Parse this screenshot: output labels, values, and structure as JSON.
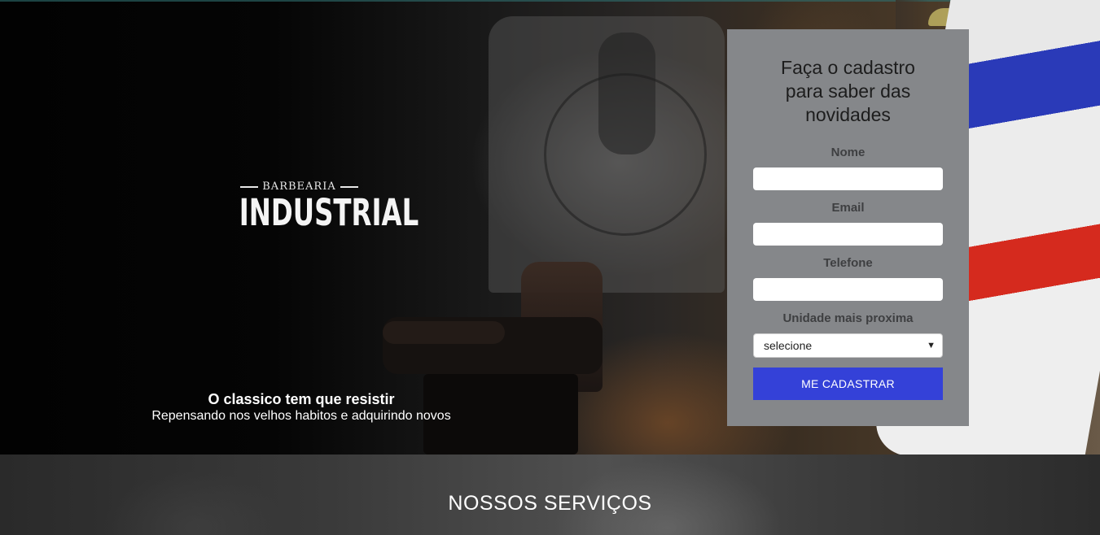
{
  "hero": {
    "logo_top": "BARBEARIA",
    "logo_main": "INDUSTRIAL",
    "tagline_title": "O classico tem que resistir",
    "tagline_sub": "Repensando nos velhos habitos e adquirindo novos"
  },
  "form": {
    "title": "Faça o cadastro para saber das novidades",
    "fields": [
      {
        "label": "Nome",
        "value": "",
        "placeholder": ""
      },
      {
        "label": "Email",
        "value": "",
        "placeholder": ""
      },
      {
        "label": "Telefone",
        "value": "",
        "placeholder": ""
      }
    ],
    "unit_label": "Unidade mais proxima",
    "unit_selected": "selecione",
    "submit_label": "ME CADASTRAR"
  },
  "services": {
    "title": "NOSSOS SERVIÇOS"
  },
  "colors": {
    "form_panel": "#85878a",
    "submit_button": "#3441d8",
    "pole_blue": "#2a3ab8",
    "pole_red": "#d52a1e"
  },
  "icons": {
    "select_chevron": "chevron-down-icon"
  }
}
